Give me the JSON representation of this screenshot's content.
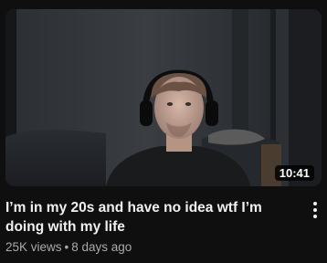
{
  "video": {
    "title": "I’m in my 20s and have no idea wtf I’m doing with my life",
    "duration": "10:41",
    "views": "25K views",
    "separator": "•",
    "age": "8 days ago"
  },
  "colors": {
    "background": "#0f0f0f",
    "title_text": "#f1f1f1",
    "meta_text": "#aaaaaa",
    "duration_bg": "#000000"
  },
  "icons": {
    "menu": "more-vert-icon"
  }
}
